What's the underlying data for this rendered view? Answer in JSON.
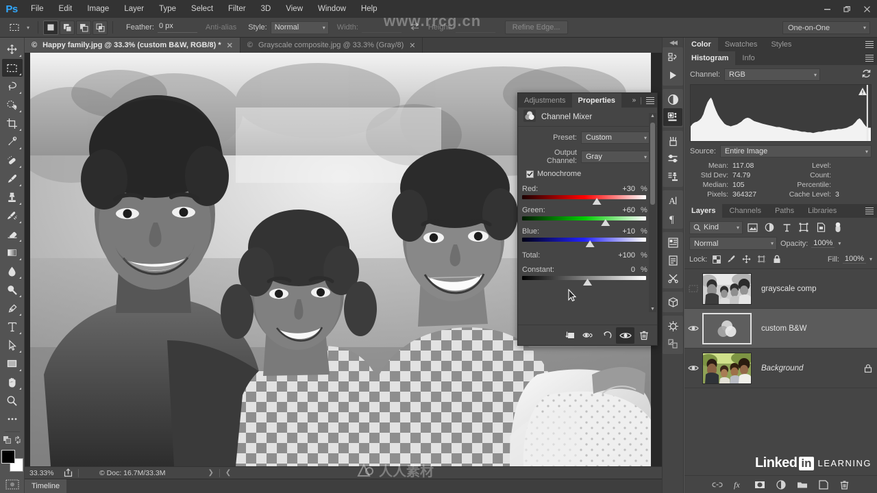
{
  "app": {
    "name": "Ps",
    "menus": [
      "File",
      "Edit",
      "Image",
      "Layer",
      "Type",
      "Select",
      "Filter",
      "3D",
      "View",
      "Window",
      "Help"
    ],
    "window_controls": {
      "minimize": "—",
      "restore": "❐",
      "close": "✕"
    }
  },
  "options_bar": {
    "feather_label": "Feather:",
    "feather_value": "0 px",
    "antialias_label": "Anti-alias",
    "style_label": "Style:",
    "style_value": "Normal",
    "width_label": "Width:",
    "width_value": "",
    "height_label": "Height:",
    "height_value": "",
    "refine_edge_label": "Refine Edge...",
    "workspace": "One-on-One"
  },
  "toolbar": {
    "tools": [
      {
        "name": "move-tool",
        "label": "Move"
      },
      {
        "name": "rectangular-marquee-tool",
        "label": "Rectangular Marquee",
        "active": true
      },
      {
        "name": "lasso-tool",
        "label": "Lasso"
      },
      {
        "name": "quick-selection-tool",
        "label": "Quick Selection"
      },
      {
        "name": "crop-tool",
        "label": "Crop"
      },
      {
        "name": "eyedropper-tool",
        "label": "Eyedropper"
      },
      {
        "name": "spot-healing-brush-tool",
        "label": "Spot Healing Brush"
      },
      {
        "name": "brush-tool",
        "label": "Brush"
      },
      {
        "name": "clone-stamp-tool",
        "label": "Clone Stamp"
      },
      {
        "name": "history-brush-tool",
        "label": "History Brush"
      },
      {
        "name": "eraser-tool",
        "label": "Eraser"
      },
      {
        "name": "gradient-tool",
        "label": "Gradient"
      },
      {
        "name": "blur-tool",
        "label": "Blur"
      },
      {
        "name": "dodge-tool",
        "label": "Dodge"
      },
      {
        "name": "pen-tool",
        "label": "Pen"
      },
      {
        "name": "type-tool",
        "label": "Type"
      },
      {
        "name": "path-selection-tool",
        "label": "Path Selection"
      },
      {
        "name": "rectangle-tool",
        "label": "Rectangle"
      },
      {
        "name": "hand-tool",
        "label": "Hand"
      },
      {
        "name": "zoom-tool",
        "label": "Zoom"
      },
      {
        "name": "edit-toolbar-tool",
        "label": "Edit Toolbar"
      }
    ],
    "foreground_color": "#000000",
    "background_color": "#ffffff"
  },
  "documents": {
    "tabs": [
      {
        "title": "Happy family.jpg @ 33.3% (custom B&W, RGB/8) *",
        "active": true
      },
      {
        "title": "Grayscale composite.jpg @ 33.3% (Gray/8)",
        "active": false
      }
    ]
  },
  "status_bar": {
    "zoom": "33.33%",
    "doc_info": "Doc: 16.7M/33.3M"
  },
  "timeline": {
    "tab_label": "Timeline"
  },
  "properties_panel": {
    "tabs": [
      {
        "label": "Adjustments",
        "active": false
      },
      {
        "label": "Properties",
        "active": true
      }
    ],
    "title": "Channel Mixer",
    "preset_label": "Preset:",
    "preset_value": "Custom",
    "output_channel_label": "Output Channel:",
    "output_channel_value": "Gray",
    "monochrome_label": "Monochrome",
    "monochrome_checked": true,
    "sliders": [
      {
        "label": "Red:",
        "value": "+30",
        "unit": "%",
        "pos": 0.6,
        "color": "red"
      },
      {
        "label": "Green:",
        "value": "+60",
        "unit": "%",
        "pos": 0.67,
        "color": "green"
      },
      {
        "label": "Blue:",
        "value": "+10",
        "unit": "%",
        "pos": 0.545,
        "color": "blue"
      }
    ],
    "total_label": "Total:",
    "total_value": "+100",
    "total_unit": "%",
    "constant_label": "Constant:",
    "constant_value": "0",
    "constant_unit": "%",
    "constant_pos": 0.525,
    "footer_buttons": [
      {
        "name": "clip-to-layer-button"
      },
      {
        "name": "toggle-preview-button"
      },
      {
        "name": "reset-button"
      },
      {
        "name": "visibility-button",
        "active": true
      },
      {
        "name": "delete-button"
      }
    ]
  },
  "histogram_panel": {
    "top_tabs": [
      {
        "label": "Color",
        "active": true
      },
      {
        "label": "Swatches",
        "active": false
      },
      {
        "label": "Styles",
        "active": false
      }
    ],
    "tabs": [
      {
        "label": "Histogram",
        "active": true
      },
      {
        "label": "Info",
        "active": false
      }
    ],
    "channel_label": "Channel:",
    "channel_value": "RGB",
    "source_label": "Source:",
    "source_value": "Entire Image",
    "stats": [
      {
        "label": "Mean:",
        "value": "117.08"
      },
      {
        "label": "Level:",
        "value": ""
      },
      {
        "label": "Std Dev:",
        "value": "74.79"
      },
      {
        "label": "Count:",
        "value": ""
      },
      {
        "label": "Median:",
        "value": "105"
      },
      {
        "label": "Percentile:",
        "value": ""
      },
      {
        "label": "Pixels:",
        "value": "364327"
      },
      {
        "label": "Cache Level:",
        "value": "3"
      }
    ]
  },
  "layers_panel": {
    "tabs": [
      {
        "label": "Layers",
        "active": true
      },
      {
        "label": "Channels",
        "active": false
      },
      {
        "label": "Paths",
        "active": false
      },
      {
        "label": "Libraries",
        "active": false
      }
    ],
    "kind_label": "Kind",
    "blend_mode": "Normal",
    "opacity_label": "Opacity:",
    "opacity_value": "100%",
    "lock_label": "Lock:",
    "fill_label": "Fill:",
    "fill_value": "100%",
    "layers": [
      {
        "name": "grayscale comp",
        "visible": false,
        "selected": false,
        "type": "image",
        "locked": false
      },
      {
        "name": "custom B&W",
        "visible": true,
        "selected": true,
        "type": "adjustment",
        "locked": false
      },
      {
        "name": "Background",
        "visible": true,
        "selected": false,
        "type": "image",
        "locked": true,
        "italic": true
      }
    ],
    "bottom_buttons": [
      {
        "name": "link-layers-button"
      },
      {
        "name": "layer-style-button"
      },
      {
        "name": "layer-mask-button"
      },
      {
        "name": "adjustment-layer-button"
      },
      {
        "name": "new-group-button"
      },
      {
        "name": "new-layer-button"
      },
      {
        "name": "delete-layer-button"
      }
    ]
  },
  "icon_dock": {
    "buttons": [
      {
        "name": "history-icon"
      },
      {
        "name": "actions-play-icon"
      },
      {
        "name": "adjustments-icon"
      },
      {
        "name": "properties-icon",
        "active": true
      },
      {
        "name": "brush-presets-icon"
      },
      {
        "name": "brush-settings-icon"
      },
      {
        "name": "clone-source-icon"
      },
      {
        "name": "character-icon"
      },
      {
        "name": "paragraph-icon"
      },
      {
        "name": "character-styles-icon"
      },
      {
        "name": "paragraph-styles-icon"
      },
      {
        "name": "tool-presets-icon"
      },
      {
        "name": "3d-icon"
      },
      {
        "name": "measurement-log-icon"
      },
      {
        "name": "notes-icon"
      }
    ]
  },
  "watermarks": {
    "top": "www.rrcg.cn",
    "bottom": "人人素材",
    "brand_linked": "Linked",
    "brand_in": "in",
    "brand_learning": "LEARNING"
  }
}
